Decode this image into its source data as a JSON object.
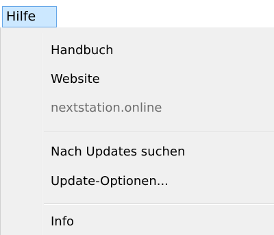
{
  "menubar": {
    "title": "Hilfe"
  },
  "menu": {
    "items": [
      {
        "label": "Handbuch"
      },
      {
        "label": "Website"
      },
      {
        "label": "nextstation.online"
      },
      {
        "label": "Nach Updates suchen"
      },
      {
        "label": "Update-Optionen..."
      },
      {
        "label": "Info"
      }
    ]
  },
  "colors": {
    "menu_highlight": "#cce8ff",
    "menu_highlight_border": "#66a7e8",
    "menu_background": "#f0f0f0",
    "disabled_text": "#6d6d6d"
  }
}
